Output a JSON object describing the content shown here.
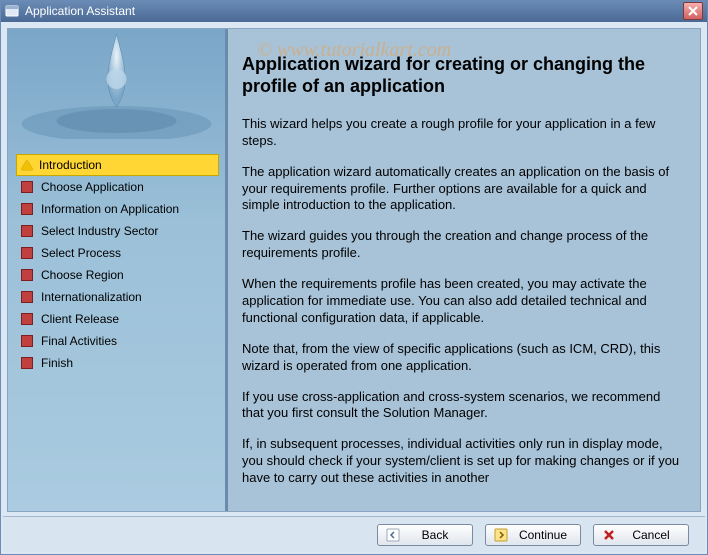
{
  "window": {
    "title": "Application Assistant"
  },
  "watermark": "© www.tutorialkart.com",
  "sidebar": {
    "items": [
      {
        "label": "Introduction",
        "selected": true
      },
      {
        "label": "Choose Application",
        "selected": false
      },
      {
        "label": "Information on Application",
        "selected": false
      },
      {
        "label": "Select Industry Sector",
        "selected": false
      },
      {
        "label": "Select Process",
        "selected": false
      },
      {
        "label": "Choose Region",
        "selected": false
      },
      {
        "label": "Internationalization",
        "selected": false
      },
      {
        "label": "Client Release",
        "selected": false
      },
      {
        "label": "Final Activities",
        "selected": false
      },
      {
        "label": "Finish",
        "selected": false
      }
    ]
  },
  "main": {
    "heading": "Application wizard for creating or changing the profile of an application",
    "paragraphs": [
      "This wizard helps you create a rough profile for your application in a few steps.",
      "The application wizard automatically creates an application on the basis of your requirements profile. Further options are available for a quick and simple introduction to the application.",
      "The wizard guides you through the creation and change process of the requirements profile.",
      "When the requirements profile has been created, you may activate the application for immediate use. You can also add detailed technical and functional configuration data, if applicable.",
      "Note that, from the view of specific applications (such as ICM, CRD), this wizard is operated from one application.",
      "If you use cross-application and cross-system scenarios, we recommend that you first consult the Solution Manager.",
      "If, in subsequent processes, individual activities only run in display mode, you should check if your system/client is set up for making changes or if you have to carry out these activities in another"
    ]
  },
  "buttons": {
    "back": "Back",
    "continue": "Continue",
    "cancel": "Cancel"
  }
}
